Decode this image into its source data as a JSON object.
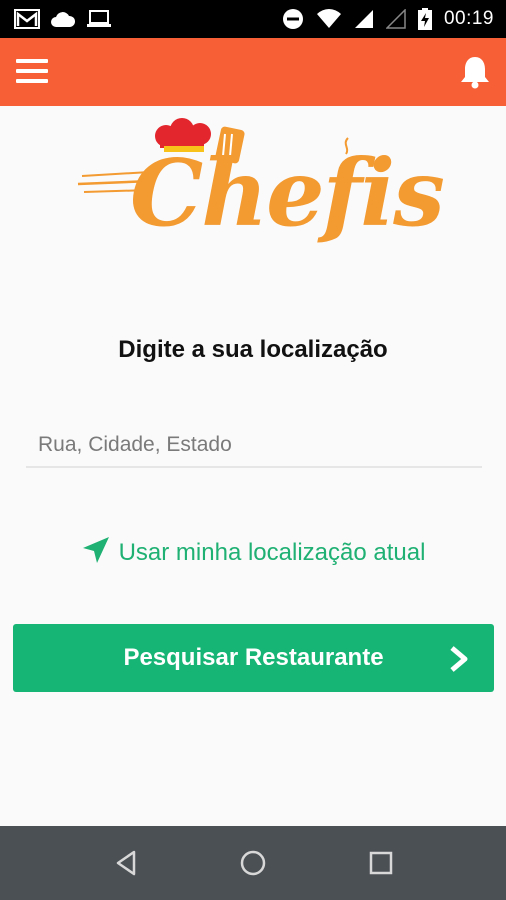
{
  "status_bar": {
    "time": "00:19",
    "icons": [
      "gmail-icon",
      "cloud-icon",
      "laptop-icon",
      "do-not-disturb-icon",
      "wifi-icon",
      "signal-icon",
      "no-signal-icon",
      "battery-charging-icon"
    ]
  },
  "app_bar": {
    "menu_icon": "hamburger-menu-icon",
    "notification_icon": "bell-icon",
    "color": "#f75f36"
  },
  "logo": {
    "text": "Chefis",
    "color": "#f39a31"
  },
  "location": {
    "heading": "Digite a sua localização",
    "input_placeholder": "Rua, Cidade, Estado",
    "input_value": "",
    "use_current_label": "Usar minha localização atual",
    "use_current_icon": "location-arrow-icon",
    "accent_color": "#1fb073"
  },
  "search_button": {
    "label": "Pesquisar Restaurante",
    "icon": "chevron-right-icon",
    "color": "#16b575"
  },
  "nav_bar": {
    "buttons": [
      "back-icon",
      "home-icon",
      "recents-icon"
    ]
  }
}
